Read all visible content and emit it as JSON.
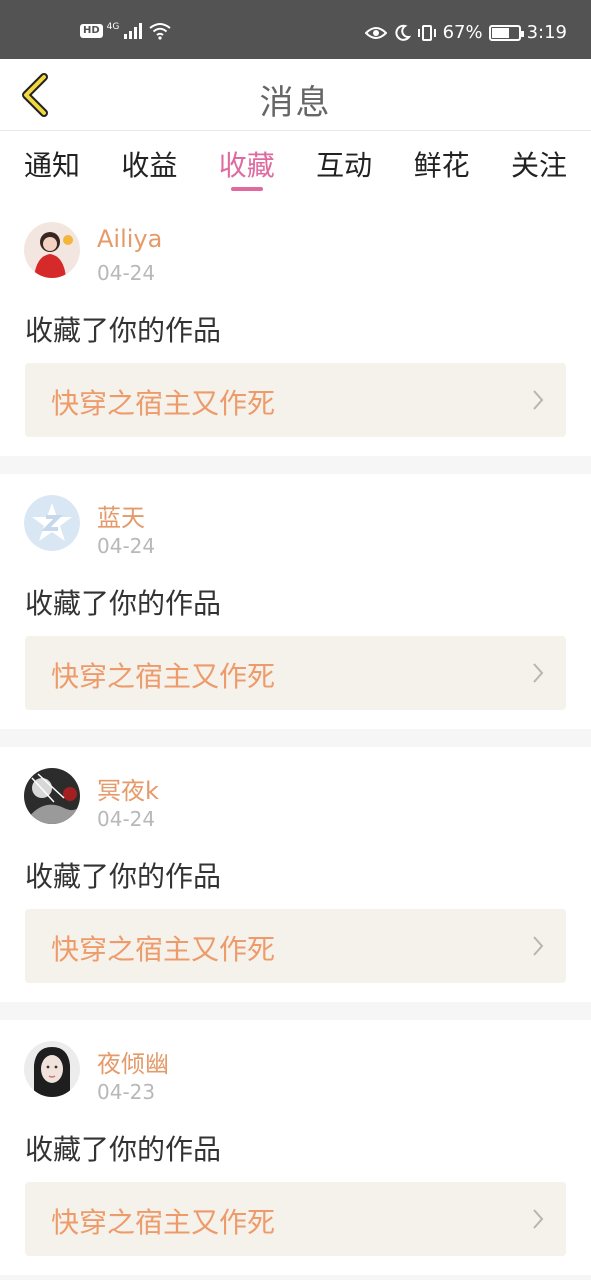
{
  "status_bar": {
    "hd": "HD",
    "network": "4G",
    "battery": "67%",
    "battery_level": 0.67,
    "time": "3:19"
  },
  "header": {
    "title": "消息",
    "back_icon": "chevron-left-icon"
  },
  "tabs": [
    {
      "label": "通知",
      "active": false
    },
    {
      "label": "收益",
      "active": false
    },
    {
      "label": "收藏",
      "active": true
    },
    {
      "label": "互动",
      "active": false
    },
    {
      "label": "鲜花",
      "active": false
    },
    {
      "label": "关注",
      "active": false
    }
  ],
  "colors": {
    "accent": "#e06aa0",
    "username": "#e59a6a",
    "work_title": "#ee9b6c",
    "work_bg": "#f4f2ea",
    "status_bar_bg": "#535353"
  },
  "messages": [
    {
      "username": "Ailiya",
      "date": "04-24",
      "action": "收藏了你的作品",
      "work_title": "快穿之宿主又作死"
    },
    {
      "username": "蓝天",
      "date": "04-24",
      "action": "收藏了你的作品",
      "work_title": "快穿之宿主又作死"
    },
    {
      "username": "冥夜k",
      "date": "04-24",
      "action": "收藏了你的作品",
      "work_title": "快穿之宿主又作死"
    },
    {
      "username": "夜倾幽",
      "date": "04-23",
      "action": "收藏了你的作品",
      "work_title": "快穿之宿主又作死"
    }
  ]
}
